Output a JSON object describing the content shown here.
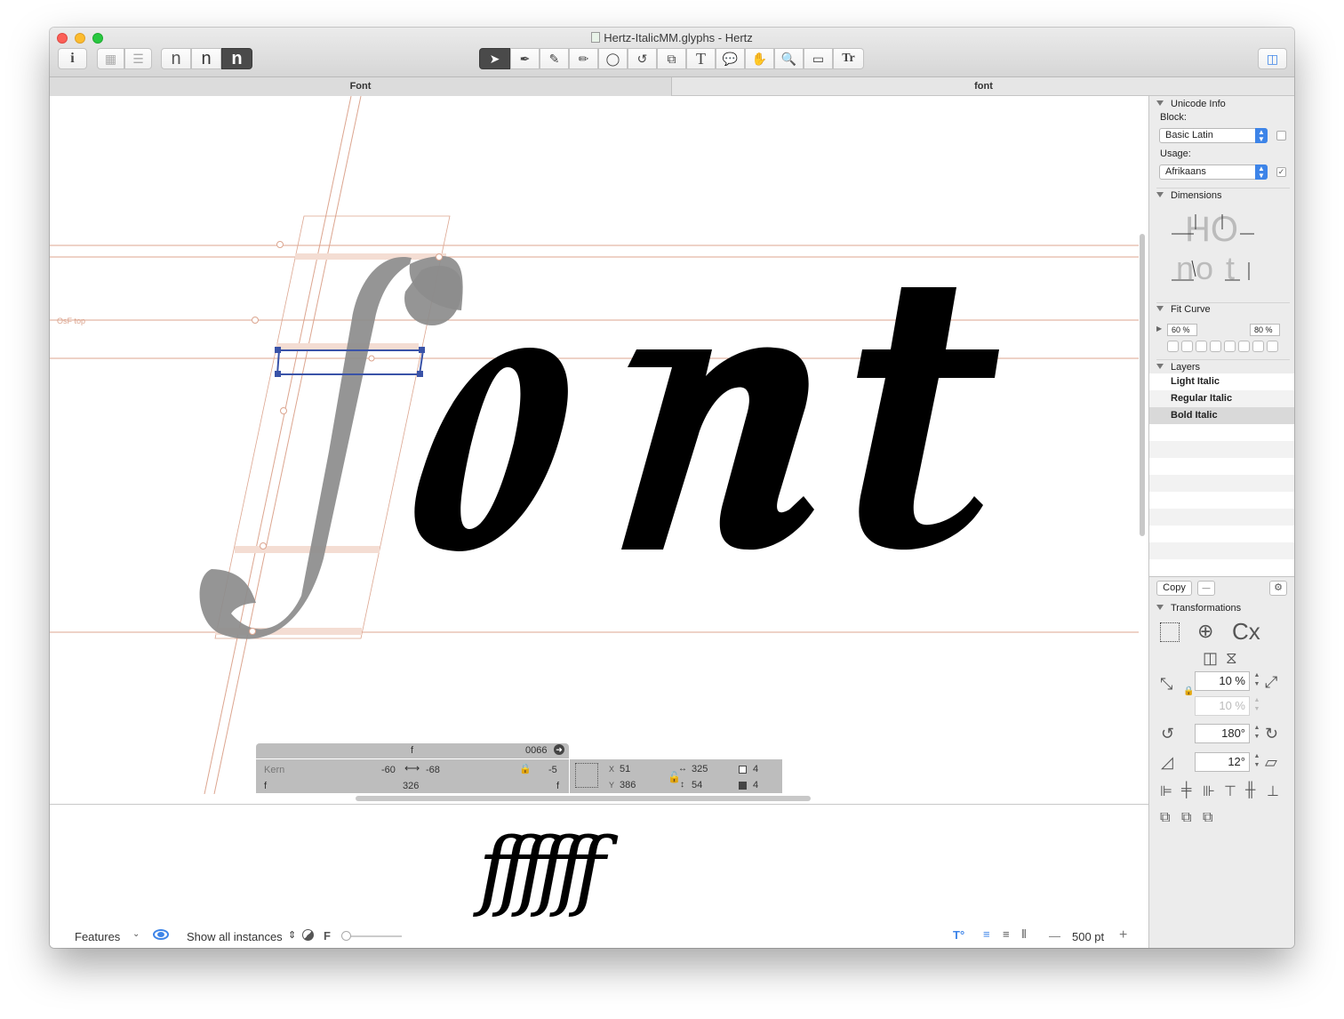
{
  "window": {
    "title": "Hertz-ItalicMM.glyphs - Hertz"
  },
  "toolbar": {
    "info": "i",
    "view_n": [
      "n",
      "n",
      "n"
    ],
    "tools": [
      "select-tool",
      "draw-tool",
      "pencil-tool",
      "brush-tool",
      "primitives-tool",
      "rotate-tool",
      "scale-tool",
      "text-tool",
      "annotation-tool",
      "hand-tool",
      "zoom-tool",
      "measurement-tool",
      "type-tool"
    ]
  },
  "tabs": [
    {
      "label": "Font"
    },
    {
      "label": "font"
    }
  ],
  "canvas": {
    "text": "font",
    "metric_label": "OsF top",
    "colors": {
      "guide": "#dca58f",
      "glyph": "#000000",
      "inactive_glyph": "#8c8c8c",
      "selection": "#3a53a8"
    }
  },
  "info_panel": {
    "glyph_name": "f",
    "unicode": "0066",
    "kern_label": "Kern",
    "lsb": "-60",
    "rsb": "-68",
    "kern_value": "-5",
    "left_glyph": "f",
    "width": "326",
    "right_glyph": "f",
    "x_label": "X",
    "x": "51",
    "y_label": "Y",
    "y": "386",
    "w": "325",
    "h": "54",
    "nodes_open": "4",
    "nodes_closed": "4"
  },
  "preview": {
    "text": "ffffff"
  },
  "bottom_bar": {
    "features": "Features",
    "instances": "Show all instances",
    "f_label": "F",
    "size": "500 pt",
    "minus": "—",
    "plus": "+"
  },
  "sidebar": {
    "unicode_info": {
      "header": "Unicode Info",
      "block_label": "Block:",
      "block_value": "Basic Latin",
      "usage_label": "Usage:",
      "usage_value": "Afrikaans",
      "usage_checked": "✓"
    },
    "dimensions": {
      "header": "Dimensions",
      "sample1": "HO",
      "sample2": "no t"
    },
    "fit_curve": {
      "header": "Fit Curve",
      "min": "60 %",
      "max": "80 %"
    },
    "layers": {
      "header": "Layers",
      "items": [
        {
          "name": "Light Italic"
        },
        {
          "name": "Regular Italic"
        },
        {
          "name": "Bold Italic"
        }
      ]
    },
    "copy_button": "Copy",
    "transformations": {
      "header": "Transformations",
      "cx_label": "Cx",
      "scale": "10 %",
      "scale2": "10 %",
      "rotate": "180°",
      "slant": "12°"
    }
  }
}
